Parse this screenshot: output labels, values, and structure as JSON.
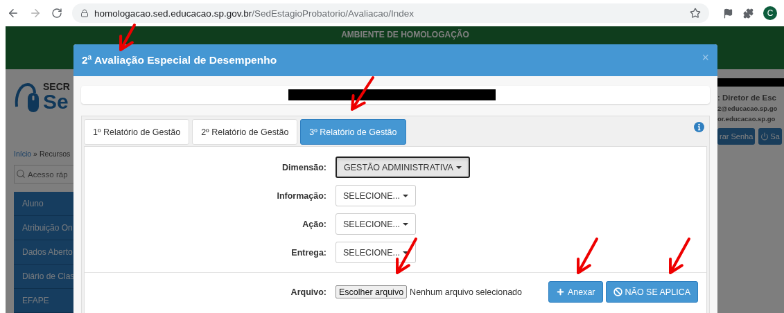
{
  "browser": {
    "url_host": "homologacao.sed.educacao.sp.gov.br",
    "url_path": "/SedEstagioProbatorio/Avaliacao/Index",
    "profile_initial": "C"
  },
  "background_page": {
    "banner": "AMBIENTE DE HOMOLOGAÇÃO",
    "logo_lines": [
      "SECR",
      "Se"
    ],
    "breadcrumb": {
      "home": "Início",
      "separator": "»",
      "current": "Recursos"
    },
    "search": {
      "placeholder": "Acesso ráp"
    },
    "menu": [
      "Aluno",
      "Atribuição On",
      "Dados Aberto",
      "Diário de Clas",
      "EFAPE"
    ],
    "user_role": ": Diretor de Esc",
    "emails": [
      "2@educacao.sp.go",
      "or.educacao.sp.go"
    ],
    "buttons": [
      {
        "label": "rar Senha",
        "kind": "plain"
      },
      {
        "label": "Sa",
        "kind": "power"
      }
    ]
  },
  "modal": {
    "title": "2ª Avaliação Especial de Desempenho",
    "close": "×",
    "tabs": [
      {
        "label": "1º Relatório de Gestão",
        "selected": false
      },
      {
        "label": "2º Relatório de Gestão",
        "selected": false
      },
      {
        "label": "3º Relatório de Gestão",
        "selected": true
      }
    ],
    "fields": [
      {
        "label": "Dimensão:",
        "value": "GESTÃO ADMINISTRATIVA",
        "active": true
      },
      {
        "label": "Informação:",
        "value": "SELECIONE...",
        "active": false
      },
      {
        "label": "Ação:",
        "value": "SELECIONE...",
        "active": false
      },
      {
        "label": "Entrega:",
        "value": "SELECIONE...",
        "active": false
      }
    ],
    "file": {
      "label": "Arquivo:",
      "button": "Escolher arquivo",
      "status": "Nenhum arquivo selecionado"
    },
    "actions": [
      {
        "label": "Anexar",
        "kind": "add"
      },
      {
        "label": "NÃO SE APLICA",
        "kind": "not_applicable"
      }
    ]
  }
}
